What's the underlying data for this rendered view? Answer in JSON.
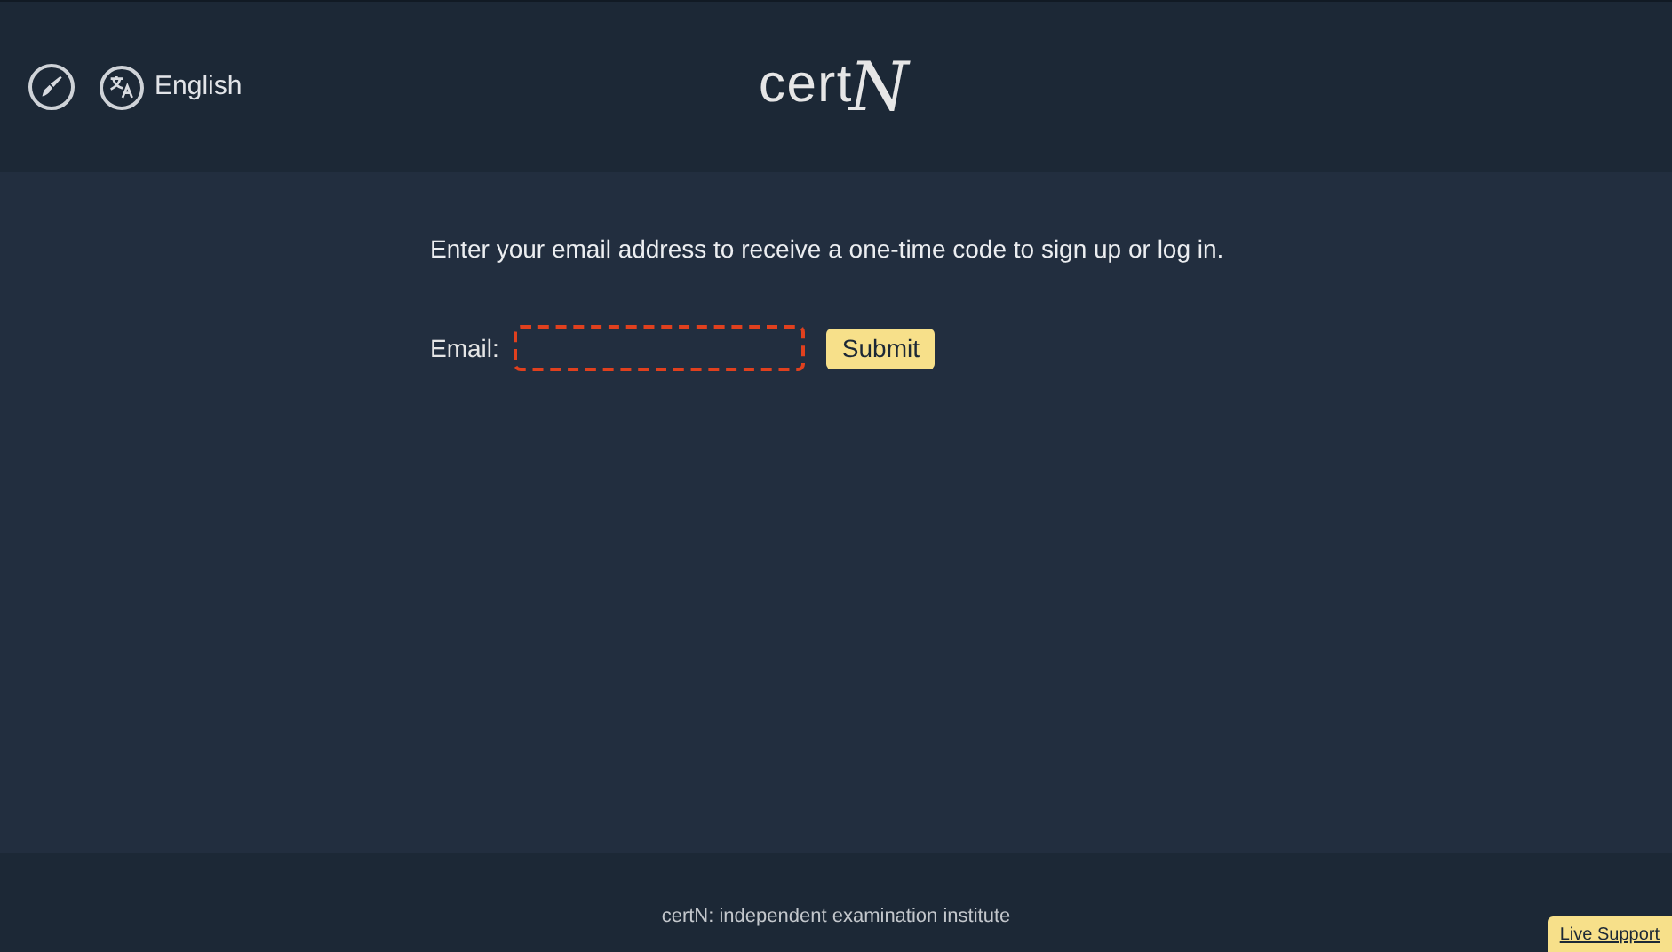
{
  "header": {
    "language": "English",
    "logo": {
      "text": "cert",
      "mark": "N"
    }
  },
  "main": {
    "intro": "Enter your email address to receive a one-time code to sign up or log in.",
    "email_label": "Email:",
    "email_field": {
      "focused": true
    },
    "submit": "Submit"
  },
  "footer": {
    "text": "certN: independent examination institute",
    "live_support": "Live Support"
  }
}
